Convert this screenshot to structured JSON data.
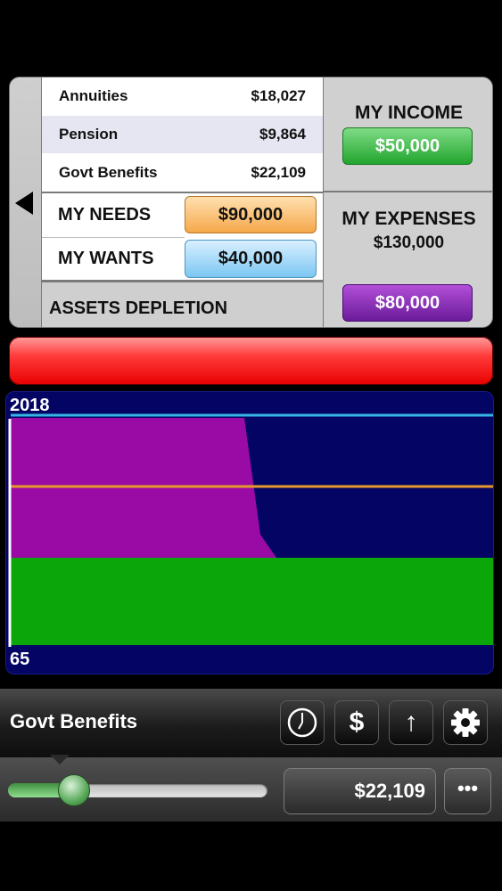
{
  "income_sources": [
    {
      "label": "Annuities",
      "value": "$18,027"
    },
    {
      "label": "Pension",
      "value": "$9,864"
    },
    {
      "label": "Govt Benefits",
      "value": "$22,109"
    }
  ],
  "my_income": {
    "label": "MY INCOME",
    "value": "$50,000"
  },
  "my_needs": {
    "label": "MY NEEDS",
    "value": "$90,000"
  },
  "my_wants": {
    "label": "MY WANTS",
    "value": "$40,000"
  },
  "my_expenses": {
    "label": "MY EXPENSES",
    "value": "$130,000"
  },
  "assets_depletion": {
    "label": "ASSETS DEPLETION",
    "value": "$80,000"
  },
  "chart": {
    "top_label": "2018",
    "bottom_label": "65",
    "colors": {
      "background": "#040464",
      "assets": "#9a0aa5",
      "income": "#0aa60a",
      "needs_line": "#e79a2c",
      "expenses_line": "#35b6e6"
    }
  },
  "toolbar": {
    "title": "Govt Benefits",
    "icons": [
      "clock-icon",
      "dollar-icon",
      "arrow-up-icon",
      "gear-icon"
    ],
    "dollar_glyph": "$",
    "arrow_glyph": "↑"
  },
  "slider": {
    "fraction": 0.255
  },
  "value_field": {
    "value": "$22,109"
  },
  "more_button": {
    "label": "•••"
  }
}
